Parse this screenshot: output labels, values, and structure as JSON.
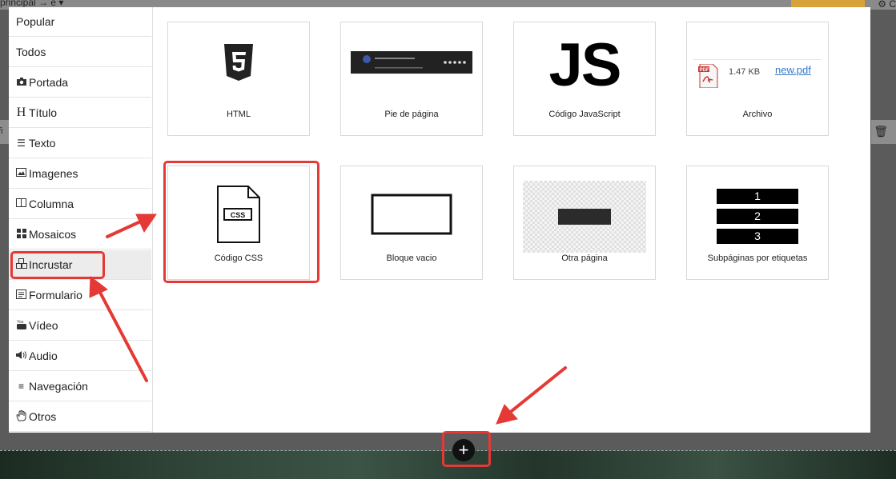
{
  "background": {
    "crumb": "principal → e ▾",
    "gear_text": "⚙ C",
    "left_strip_text": "fi",
    "trash_icon": "trash-icon"
  },
  "sidebar": {
    "items": [
      {
        "label": "Popular",
        "icon": ""
      },
      {
        "label": "Todos",
        "icon": ""
      },
      {
        "label": "Portada",
        "icon": "camera-icon"
      },
      {
        "label": "Título",
        "icon": "heading-icon"
      },
      {
        "label": "Texto",
        "icon": "text-lines-icon"
      },
      {
        "label": "Imagenes",
        "icon": "image-icon"
      },
      {
        "label": "Columna",
        "icon": "columns-icon"
      },
      {
        "label": "Mosaicos",
        "icon": "grid-icon"
      },
      {
        "label": "Incrustar",
        "icon": "cubes-icon"
      },
      {
        "label": "Formulario",
        "icon": "form-icon"
      },
      {
        "label": "Vídeo",
        "icon": "youtube-icon"
      },
      {
        "label": "Audio",
        "icon": "speaker-icon"
      },
      {
        "label": "Navegación",
        "icon": "menu-icon"
      },
      {
        "label": "Otros",
        "icon": "hand-icon"
      }
    ],
    "active_index": 8
  },
  "tiles": [
    {
      "label": "HTML"
    },
    {
      "label": "Pie de página"
    },
    {
      "label": "Código JavaScript",
      "art_text": "JS"
    },
    {
      "label": "Archivo",
      "file_size": "1.47 KB",
      "file_name": "new.pdf"
    },
    {
      "label": "Código CSS",
      "art_text": "CSS"
    },
    {
      "label": "Bloque vacio"
    },
    {
      "label": "Otra página"
    },
    {
      "label": "Subpáginas por etiquetas",
      "bars": [
        "1",
        "2",
        "3"
      ]
    }
  ],
  "fab_icon": "plus-icon",
  "colors": {
    "highlight": "#e53935",
    "active_bg": "#ececec"
  }
}
